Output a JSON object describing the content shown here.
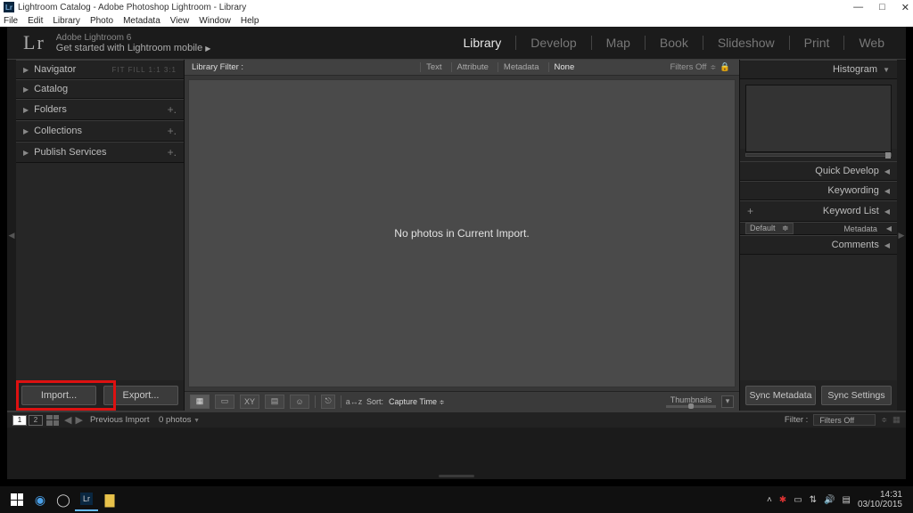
{
  "window": {
    "title": "Lightroom Catalog - Adobe Photoshop Lightroom - Library"
  },
  "menu": [
    "File",
    "Edit",
    "Library",
    "Photo",
    "Metadata",
    "View",
    "Window",
    "Help"
  ],
  "brand": {
    "logo": "Lr",
    "line1": "Adobe Lightroom 6",
    "line2": "Get started with Lightroom mobile"
  },
  "modules": [
    "Library",
    "Develop",
    "Map",
    "Book",
    "Slideshow",
    "Print",
    "Web"
  ],
  "active_module": "Library",
  "left": {
    "navigator": {
      "label": "Navigator",
      "tags": "FIT  FILL  1:1  3:1"
    },
    "catalog": "Catalog",
    "folders": "Folders",
    "collections": "Collections",
    "publish": "Publish Services",
    "import_btn": "Import...",
    "export_btn": "Export..."
  },
  "filter": {
    "label": "Library Filter :",
    "text": "Text",
    "attribute": "Attribute",
    "metadata": "Metadata",
    "none": "None",
    "off": "Filters Off"
  },
  "grid": {
    "empty": "No photos in Current Import."
  },
  "toolbar": {
    "sort_label": "Sort:",
    "sort_value": "Capture Time",
    "thumbs_label": "Thumbnails"
  },
  "right": {
    "histogram": "Histogram",
    "quick": "Quick Develop",
    "keywording": "Keywording",
    "keylist": "Keyword List",
    "metadata": "Metadata",
    "metadata_set": "Default",
    "comments": "Comments",
    "sync_meta": "Sync Metadata",
    "sync_set": "Sync Settings"
  },
  "info": {
    "prev": "Previous Import",
    "count": "0 photos",
    "filter_label": "Filter :",
    "filter_value": "Filters Off"
  },
  "taskbar": {
    "time": "14:31",
    "date": "03/10/2015"
  }
}
